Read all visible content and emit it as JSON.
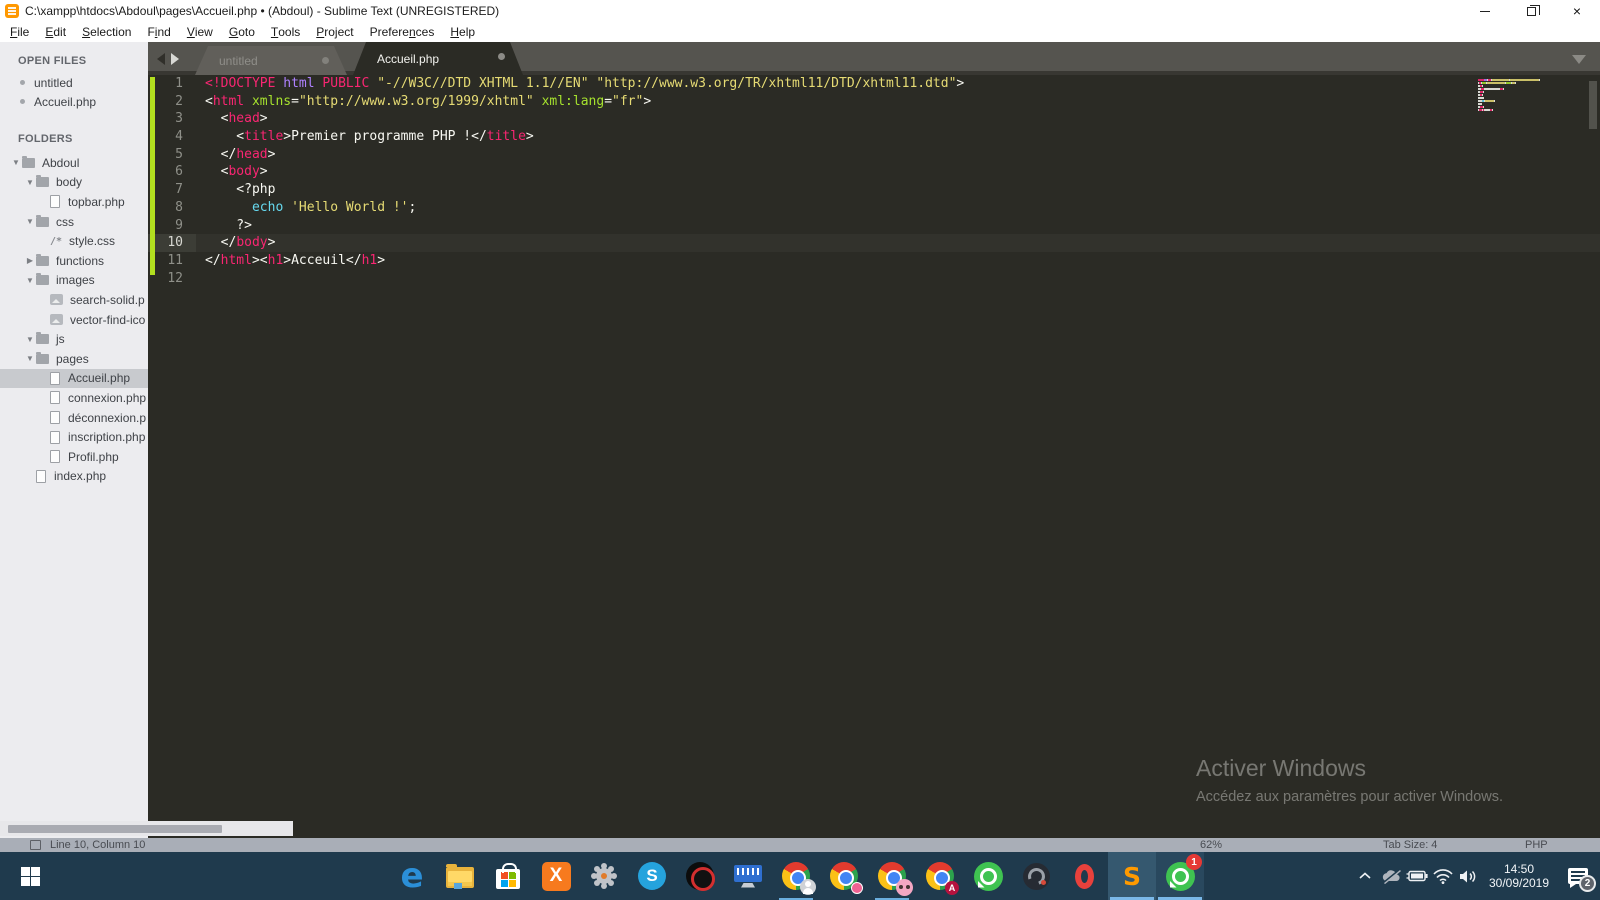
{
  "window": {
    "title": "C:\\xampp\\htdocs\\Abdoul\\pages\\Accueil.php • (Abdoul) - Sublime Text (UNREGISTERED)"
  },
  "menu": [
    {
      "label": "File",
      "key": 0
    },
    {
      "label": "Edit",
      "key": 0
    },
    {
      "label": "Selection",
      "key": 0
    },
    {
      "label": "Find",
      "key": 1
    },
    {
      "label": "View",
      "key": 0
    },
    {
      "label": "Goto",
      "key": 0
    },
    {
      "label": "Tools",
      "key": 0
    },
    {
      "label": "Project",
      "key": 0
    },
    {
      "label": "Preferences",
      "key": 7
    },
    {
      "label": "Help",
      "key": 0
    }
  ],
  "sidebar": {
    "open_files_header": "OPEN FILES",
    "open_files": [
      {
        "label": "untitled"
      },
      {
        "label": "Accueil.php"
      }
    ],
    "folders_header": "FOLDERS",
    "tree": [
      {
        "label": "Abdoul",
        "type": "folder",
        "depth": 0,
        "expanded": true
      },
      {
        "label": "body",
        "type": "folder",
        "depth": 1,
        "expanded": true
      },
      {
        "label": "topbar.php",
        "type": "file",
        "depth": 2
      },
      {
        "label": "css",
        "type": "folder",
        "depth": 1,
        "expanded": true
      },
      {
        "label": "style.css",
        "type": "css",
        "depth": 2
      },
      {
        "label": "functions",
        "type": "folder",
        "depth": 1,
        "expanded": false
      },
      {
        "label": "images",
        "type": "folder",
        "depth": 1,
        "expanded": true
      },
      {
        "label": "search-solid.p",
        "type": "image",
        "depth": 2
      },
      {
        "label": "vector-find-ico",
        "type": "image",
        "depth": 2
      },
      {
        "label": "js",
        "type": "folder",
        "depth": 1,
        "expanded": true
      },
      {
        "label": "pages",
        "type": "folder",
        "depth": 1,
        "expanded": true
      },
      {
        "label": "Accueil.php",
        "type": "file",
        "depth": 2,
        "selected": true
      },
      {
        "label": "connexion.php",
        "type": "file",
        "depth": 2
      },
      {
        "label": "déconnexion.p",
        "type": "file",
        "depth": 2
      },
      {
        "label": "inscription.php",
        "type": "file",
        "depth": 2
      },
      {
        "label": "Profil.php",
        "type": "file",
        "depth": 2
      },
      {
        "label": "index.php",
        "type": "file",
        "depth": 1
      }
    ]
  },
  "tabbar": {
    "tabs": [
      {
        "label": "untitled",
        "active": false,
        "modified": true
      },
      {
        "label": "Accueil.php",
        "active": true,
        "modified": true
      }
    ]
  },
  "editor": {
    "current_line": 10,
    "lines": [
      [
        [
          "r",
          "<!DOCTYPE "
        ],
        [
          "p",
          "html"
        ],
        [
          "t",
          " "
        ],
        [
          "r",
          "PUBLIC"
        ],
        [
          "t",
          " "
        ],
        [
          "y",
          "\"-//W3C//DTD XHTML 1.1//EN\""
        ],
        [
          "t",
          " "
        ],
        [
          "y",
          "\"http://www.w3.org/TR/xhtml11/DTD/xhtml11.dtd\""
        ],
        [
          "t",
          ">"
        ]
      ],
      [
        [
          "t",
          "<"
        ],
        [
          "r",
          "html"
        ],
        [
          "t",
          " "
        ],
        [
          "g",
          "xmlns"
        ],
        [
          "t",
          "="
        ],
        [
          "y",
          "\"http://www.w3.org/1999/xhtml\""
        ],
        [
          "t",
          " "
        ],
        [
          "g",
          "xml:lang"
        ],
        [
          "t",
          "="
        ],
        [
          "y",
          "\"fr\""
        ],
        [
          "t",
          ">"
        ]
      ],
      [
        [
          "t",
          "  <"
        ],
        [
          "r",
          "head"
        ],
        [
          "t",
          ">"
        ]
      ],
      [
        [
          "t",
          "    <"
        ],
        [
          "r",
          "title"
        ],
        [
          "t",
          ">Premier programme PHP !</"
        ],
        [
          "r",
          "title"
        ],
        [
          "t",
          ">"
        ]
      ],
      [
        [
          "t",
          "  </"
        ],
        [
          "r",
          "head"
        ],
        [
          "t",
          ">"
        ]
      ],
      [
        [
          "t",
          "  <"
        ],
        [
          "r",
          "body"
        ],
        [
          "t",
          ">"
        ]
      ],
      [
        [
          "t",
          "    <?php"
        ]
      ],
      [
        [
          "t",
          "      "
        ],
        [
          "c",
          "echo"
        ],
        [
          "t",
          " "
        ],
        [
          "y",
          "'Hello World !'"
        ],
        [
          "t",
          ";"
        ]
      ],
      [
        [
          "t",
          "    ?>"
        ]
      ],
      [
        [
          "t",
          "  </"
        ],
        [
          "r",
          "body"
        ],
        [
          "t",
          ">"
        ]
      ],
      [
        [
          "t",
          "</"
        ],
        [
          "r",
          "html"
        ],
        [
          "t",
          "><"
        ],
        [
          "r",
          "h1"
        ],
        [
          "t",
          ">Acceuil</"
        ],
        [
          "r",
          "h1"
        ],
        [
          "t",
          ">"
        ]
      ],
      []
    ]
  },
  "watermark": {
    "line1": "Activer Windows",
    "line2": "Accédez aux paramètres pour activer Windows."
  },
  "statusbar": {
    "position": "Line 10, Column 10",
    "zoom": "62%",
    "tab_size": "Tab Size: 4",
    "syntax": "PHP"
  },
  "taskbar": {
    "apps": [
      {
        "name": "edge"
      },
      {
        "name": "file-explorer"
      },
      {
        "name": "microsoft-store"
      },
      {
        "name": "xampp"
      },
      {
        "name": "settings-gear"
      },
      {
        "name": "skype"
      },
      {
        "name": "screen-recorder"
      },
      {
        "name": "on-screen-keyboard"
      },
      {
        "name": "chrome-profile-1",
        "running": true,
        "badge": "person"
      },
      {
        "name": "chrome-profile-2",
        "badge": "pink"
      },
      {
        "name": "chrome-profile-3",
        "running": true,
        "badge": "glasses"
      },
      {
        "name": "chrome-profile-4",
        "badge": "a"
      },
      {
        "name": "whatsapp"
      },
      {
        "name": "loop-app"
      },
      {
        "name": "opera"
      },
      {
        "name": "sublime-text",
        "active": true
      },
      {
        "name": "whatsapp-desktop",
        "active2": true,
        "count": "1"
      }
    ],
    "tray": {
      "time": "14:50",
      "date": "30/09/2019",
      "notification_count": "2"
    },
    "labels": {
      "xampp": "X",
      "skype": "S",
      "edge": "e",
      "sublime": "S"
    }
  }
}
